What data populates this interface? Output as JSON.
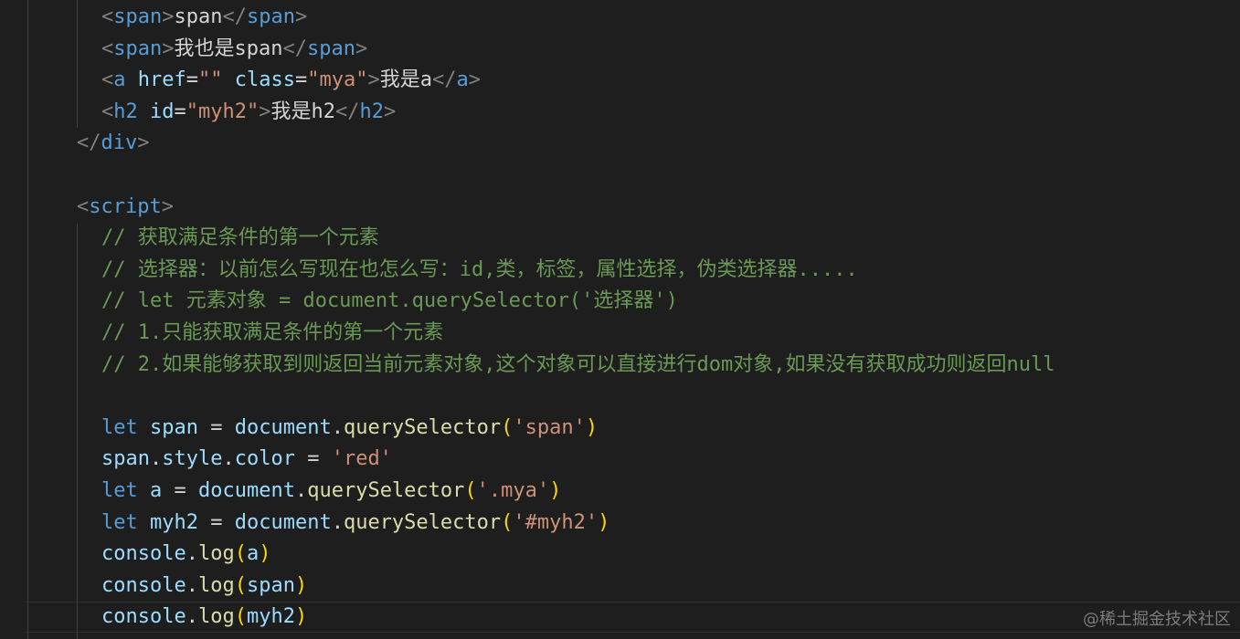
{
  "editor": {
    "html_lines": [
      [
        {
          "t": "<",
          "c": "punct"
        },
        {
          "t": "span",
          "c": "tag"
        },
        {
          "t": ">",
          "c": "punct"
        },
        {
          "t": "span",
          "c": "text"
        },
        {
          "t": "</",
          "c": "punct"
        },
        {
          "t": "span",
          "c": "tag"
        },
        {
          "t": ">",
          "c": "punct"
        }
      ],
      [
        {
          "t": "<",
          "c": "punct"
        },
        {
          "t": "span",
          "c": "tag"
        },
        {
          "t": ">",
          "c": "punct"
        },
        {
          "t": "我也是span",
          "c": "text"
        },
        {
          "t": "</",
          "c": "punct"
        },
        {
          "t": "span",
          "c": "tag"
        },
        {
          "t": ">",
          "c": "punct"
        }
      ],
      [
        {
          "t": "<",
          "c": "punct"
        },
        {
          "t": "a",
          "c": "tag"
        },
        {
          "t": " ",
          "c": "text"
        },
        {
          "t": "href",
          "c": "attr"
        },
        {
          "t": "=",
          "c": "text"
        },
        {
          "t": "\"\"",
          "c": "str"
        },
        {
          "t": " ",
          "c": "text"
        },
        {
          "t": "class",
          "c": "attr"
        },
        {
          "t": "=",
          "c": "text"
        },
        {
          "t": "\"mya\"",
          "c": "str"
        },
        {
          "t": ">",
          "c": "punct"
        },
        {
          "t": "我是a",
          "c": "text"
        },
        {
          "t": "</",
          "c": "punct"
        },
        {
          "t": "a",
          "c": "tag"
        },
        {
          "t": ">",
          "c": "punct"
        }
      ],
      [
        {
          "t": "<",
          "c": "punct"
        },
        {
          "t": "h2",
          "c": "tag"
        },
        {
          "t": " ",
          "c": "text"
        },
        {
          "t": "id",
          "c": "attr"
        },
        {
          "t": "=",
          "c": "text"
        },
        {
          "t": "\"myh2\"",
          "c": "str"
        },
        {
          "t": ">",
          "c": "punct"
        },
        {
          "t": "我是h2",
          "c": "text"
        },
        {
          "t": "</",
          "c": "punct"
        },
        {
          "t": "h2",
          "c": "tag"
        },
        {
          "t": ">",
          "c": "punct"
        }
      ],
      [
        {
          "t": "</",
          "c": "punct"
        },
        {
          "t": "div",
          "c": "tag"
        },
        {
          "t": ">",
          "c": "punct"
        }
      ],
      [],
      [
        {
          "t": "<",
          "c": "punct"
        },
        {
          "t": "script",
          "c": "tag"
        },
        {
          "t": ">",
          "c": "punct"
        }
      ]
    ],
    "comment_lines": [
      "// 获取满足条件的第一个元素",
      "// 选择器：以前怎么写现在也怎么写：id,类，标签，属性选择，伪类选择器.....",
      "// let 元素对象 = document.querySelector('选择器')",
      "// 1.只能获取满足条件的第一个元素",
      "// 2.如果能够获取到则返回当前元素对象,这个对象可以直接进行dom对象,如果没有获取成功则返回null"
    ],
    "js_lines": [
      [
        {
          "t": "let",
          "c": "kw"
        },
        {
          "t": " ",
          "c": "plain"
        },
        {
          "t": "span",
          "c": "var"
        },
        {
          "t": " = ",
          "c": "plain"
        },
        {
          "t": "document",
          "c": "var"
        },
        {
          "t": ".",
          "c": "plain"
        },
        {
          "t": "querySelector",
          "c": "fn"
        },
        {
          "t": "(",
          "c": "paren"
        },
        {
          "t": "'span'",
          "c": "str"
        },
        {
          "t": ")",
          "c": "paren"
        }
      ],
      [
        {
          "t": "span",
          "c": "var"
        },
        {
          "t": ".",
          "c": "plain"
        },
        {
          "t": "style",
          "c": "var"
        },
        {
          "t": ".",
          "c": "plain"
        },
        {
          "t": "color",
          "c": "var"
        },
        {
          "t": " = ",
          "c": "plain"
        },
        {
          "t": "'red'",
          "c": "str"
        }
      ],
      [
        {
          "t": "let",
          "c": "kw"
        },
        {
          "t": " ",
          "c": "plain"
        },
        {
          "t": "a",
          "c": "var"
        },
        {
          "t": " = ",
          "c": "plain"
        },
        {
          "t": "document",
          "c": "var"
        },
        {
          "t": ".",
          "c": "plain"
        },
        {
          "t": "querySelector",
          "c": "fn"
        },
        {
          "t": "(",
          "c": "paren"
        },
        {
          "t": "'.mya'",
          "c": "str"
        },
        {
          "t": ")",
          "c": "paren"
        }
      ],
      [
        {
          "t": "let",
          "c": "kw"
        },
        {
          "t": " ",
          "c": "plain"
        },
        {
          "t": "myh2",
          "c": "var"
        },
        {
          "t": " = ",
          "c": "plain"
        },
        {
          "t": "document",
          "c": "var"
        },
        {
          "t": ".",
          "c": "plain"
        },
        {
          "t": "querySelector",
          "c": "fn"
        },
        {
          "t": "(",
          "c": "paren"
        },
        {
          "t": "'#myh2'",
          "c": "str"
        },
        {
          "t": ")",
          "c": "paren"
        }
      ],
      [
        {
          "t": "console",
          "c": "var"
        },
        {
          "t": ".",
          "c": "plain"
        },
        {
          "t": "log",
          "c": "fn"
        },
        {
          "t": "(",
          "c": "paren"
        },
        {
          "t": "a",
          "c": "var"
        },
        {
          "t": ")",
          "c": "paren"
        }
      ],
      [
        {
          "t": "console",
          "c": "var"
        },
        {
          "t": ".",
          "c": "plain"
        },
        {
          "t": "log",
          "c": "fn"
        },
        {
          "t": "(",
          "c": "paren"
        },
        {
          "t": "span",
          "c": "var"
        },
        {
          "t": ")",
          "c": "paren"
        }
      ],
      [
        {
          "t": "console",
          "c": "var"
        },
        {
          "t": ".",
          "c": "plain"
        },
        {
          "t": "log",
          "c": "fn"
        },
        {
          "t": "(",
          "c": "paren"
        },
        {
          "t": "myh2",
          "c": "var"
        },
        {
          "t": ")",
          "c": "paren"
        }
      ]
    ]
  },
  "watermark": "@稀土掘金技术社区"
}
